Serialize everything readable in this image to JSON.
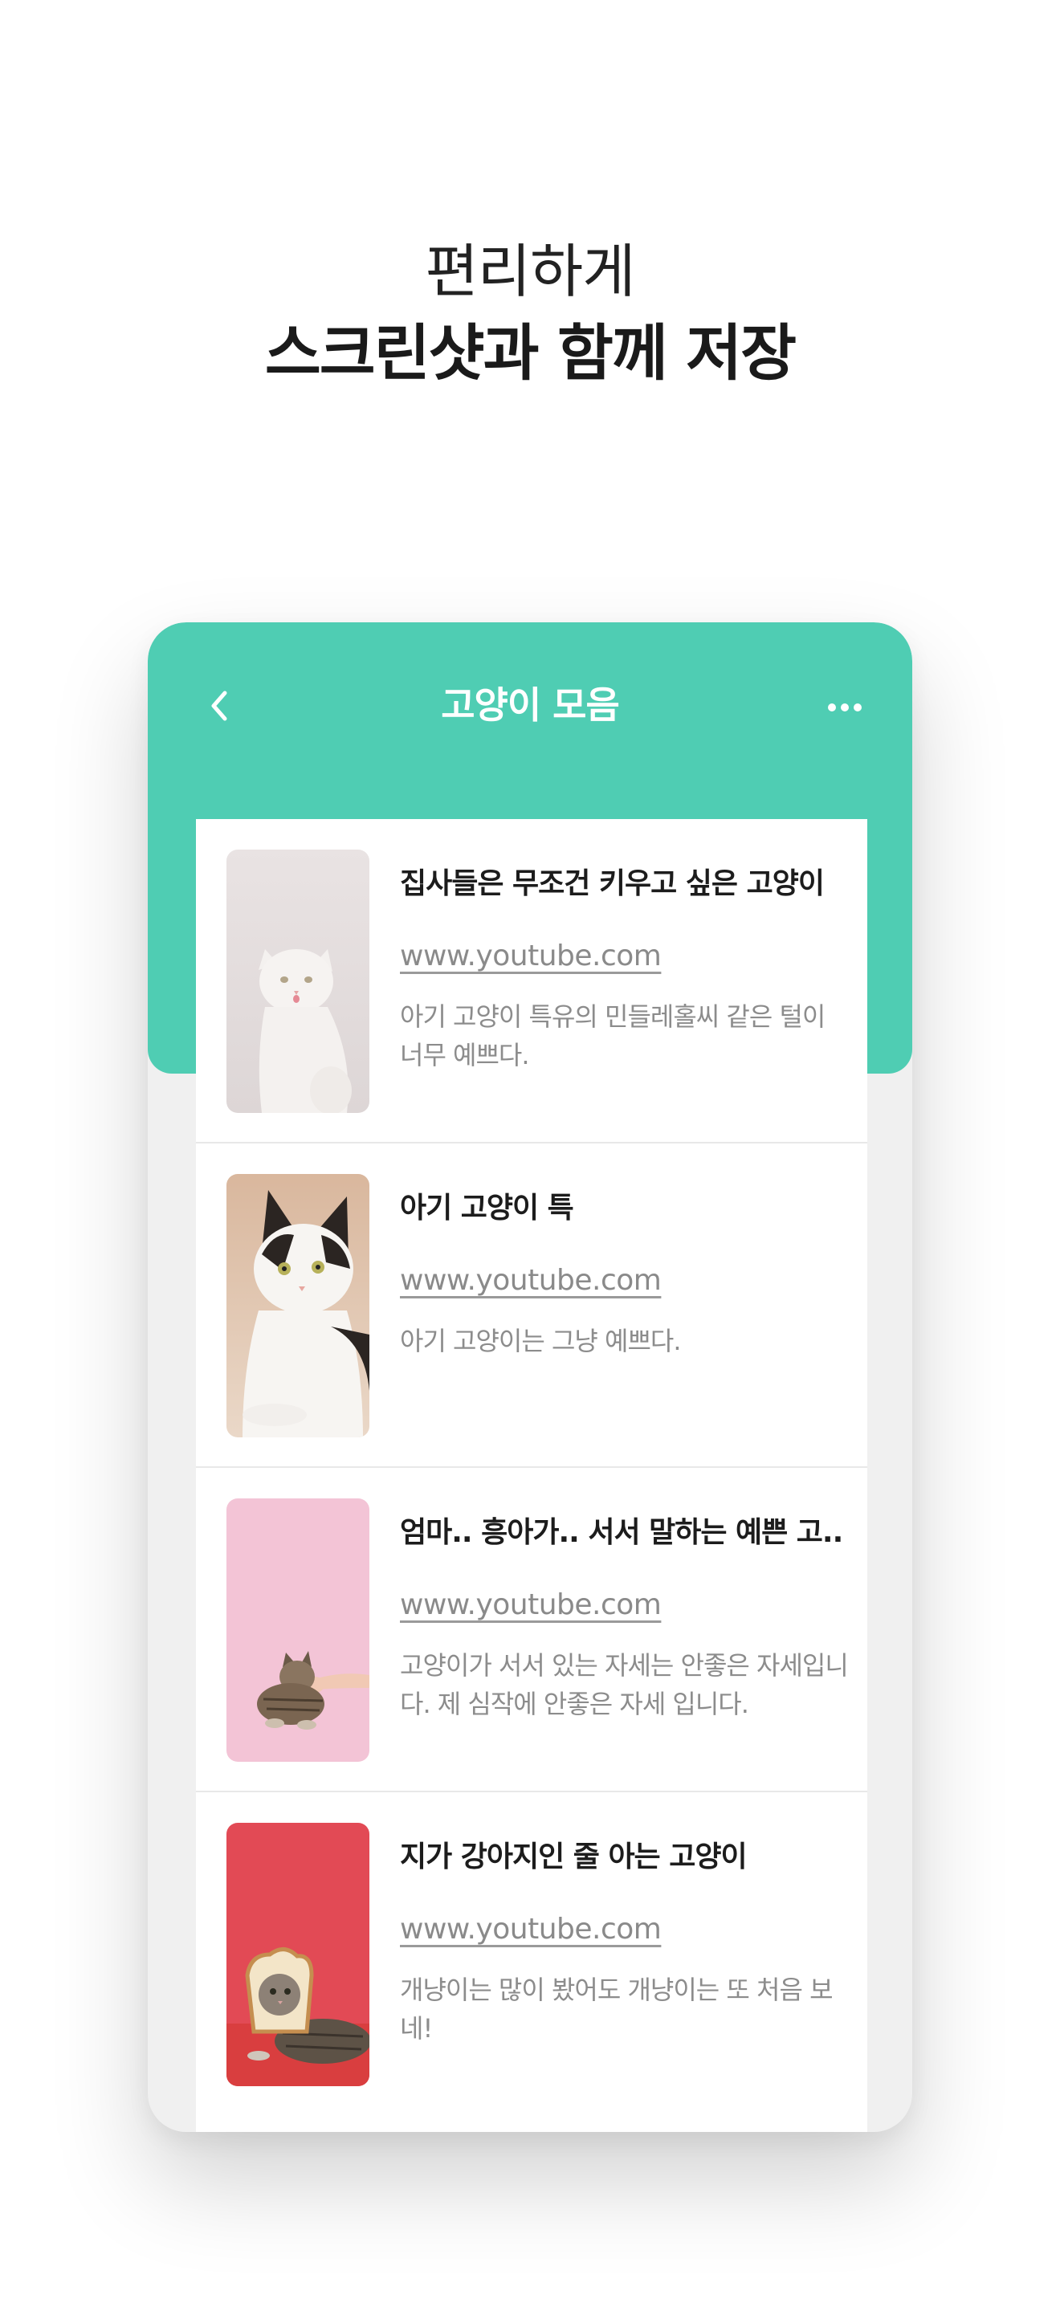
{
  "headline": {
    "line1": "편리하게",
    "line2": "스크린샷과 함께 저장"
  },
  "header": {
    "back_icon": "chevron-left-icon",
    "title": "고양이 모음",
    "more_icon": "more-horizontal-icon",
    "color": "#4fcdb3"
  },
  "items": [
    {
      "title": "집사들은 무조건 키우고 싶은 고양이",
      "url": "www.youtube.com",
      "desc": "아기 고양이 특유의 민들레홀씨 같은 털이 너무 예쁘다."
    },
    {
      "title": "아기 고양이 특",
      "url": "www.youtube.com",
      "desc": "아기 고양이는 그냥 예쁘다."
    },
    {
      "title": "엄마.. 흥아가.. 서서 말하는 예쁜 고..",
      "url": "www.youtube.com",
      "desc": "고양이가 서서 있는 자세는 안좋은 자세입니다. 제 심작에 안좋은 자세 입니다."
    },
    {
      "title": "지가 강아지인 줄 아는 고양이",
      "url": "www.youtube.com",
      "desc": "개냥이는 많이 봤어도 개냥이는 또 처음 보네!"
    }
  ]
}
